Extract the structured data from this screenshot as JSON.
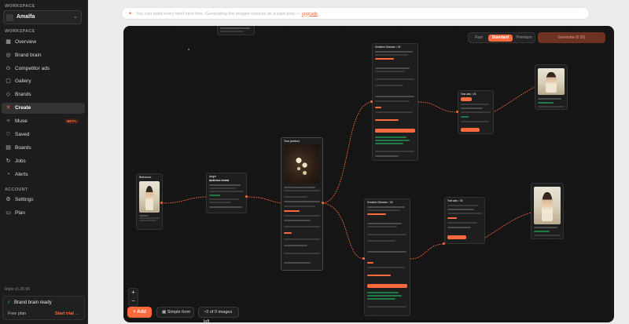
{
  "workspace": {
    "label": "WORKSPACE",
    "name": "Amalfa"
  },
  "sections": {
    "workspace": "WORKSPACE",
    "account": "ACCOUNT"
  },
  "nav": [
    {
      "label": "Overview",
      "icon": "grid-icon"
    },
    {
      "label": "Brand brain",
      "icon": "brain-icon"
    },
    {
      "label": "Competitor ads",
      "icon": "target-icon"
    },
    {
      "label": "Gallery",
      "icon": "image-icon"
    },
    {
      "label": "Brands",
      "icon": "tag-icon"
    },
    {
      "label": "Create",
      "icon": "wand-icon",
      "active": true
    },
    {
      "label": "Muse",
      "icon": "sparkle-icon",
      "badge": "BETA"
    },
    {
      "label": "Saved",
      "icon": "heart-icon"
    },
    {
      "label": "Boards",
      "icon": "board-icon"
    },
    {
      "label": "Jobs",
      "icon": "refresh-icon"
    },
    {
      "label": "Alerts",
      "icon": "bell-icon"
    }
  ],
  "account_nav": [
    {
      "label": "Settings",
      "icon": "gear-icon"
    },
    {
      "label": "Plan",
      "icon": "card-icon"
    }
  ],
  "footer": {
    "version": "Ripio v1.20.96",
    "status": "Brand brain ready",
    "plan": "Free plan",
    "trial": "Start trial →"
  },
  "banner": {
    "text": "You can build every brief here free. Generating the images unlocks on a paid plan — ",
    "link": "upgrade",
    "end": "."
  },
  "toolbar": {
    "quality_options": [
      "Fast",
      "Standard",
      "Premium"
    ],
    "selected_quality": "Standard",
    "generate_label": "Generate (0 DI)"
  },
  "bottom": {
    "zoom_in": "+",
    "zoom_out": "−",
    "add_label": "+ Add",
    "simple_form": "Simple form",
    "images_left": "~0 of 0 images left"
  },
  "nodes": {
    "reference": "Reference",
    "angle": "Angle",
    "angle_sub": "Audience review",
    "product": "Your product",
    "creative_a": "Creative Director • V1",
    "creative_b": "Creative Director • V2",
    "text_a": "Text ads • V1",
    "text_b": "Text ads • V2"
  },
  "colors": {
    "accent": "#ff6a3d",
    "canvas": "#151515",
    "sidebar": "#1c1c1c"
  }
}
